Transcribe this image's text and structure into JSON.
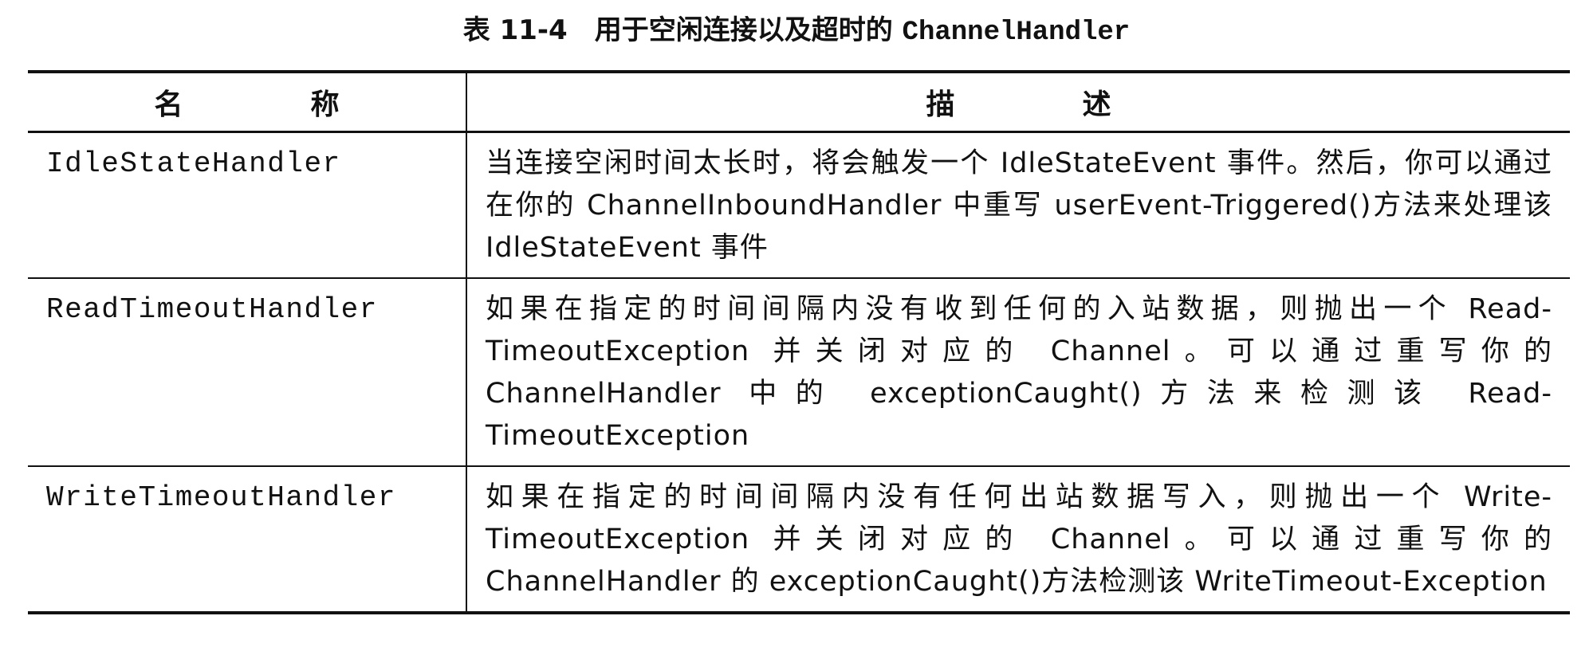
{
  "caption": {
    "prefix": "表 11-4　用于空闲连接以及超时的 ",
    "code": "ChannelHandler"
  },
  "table": {
    "headers": [
      "名　称",
      "描　述"
    ],
    "rows": [
      {
        "name": "IdleStateHandler",
        "description": "当连接空闲时间太长时，将会触发一个 IdleStateEvent 事件。然后，你可以通过在你的 ChannelInboundHandler 中重写 userEvent-Triggered()方法来处理该 IdleStateEvent 事件"
      },
      {
        "name": "ReadTimeoutHandler",
        "description": "如果在指定的时间间隔内没有收到任何的入站数据，则抛出一个 Read-TimeoutException 并关闭对应的 Channel。可以通过重写你的 ChannelHandler 中的 exceptionCaught()方法来检测该 Read-TimeoutException"
      },
      {
        "name": "WriteTimeoutHandler",
        "description": "如果在指定的时间间隔内没有任何出站数据写入，则抛出一个 Write-TimeoutException 并关闭对应的 Channel。可以通过重写你的 ChannelHandler 的 exceptionCaught()方法检测该 WriteTimeout-Exception"
      }
    ]
  }
}
